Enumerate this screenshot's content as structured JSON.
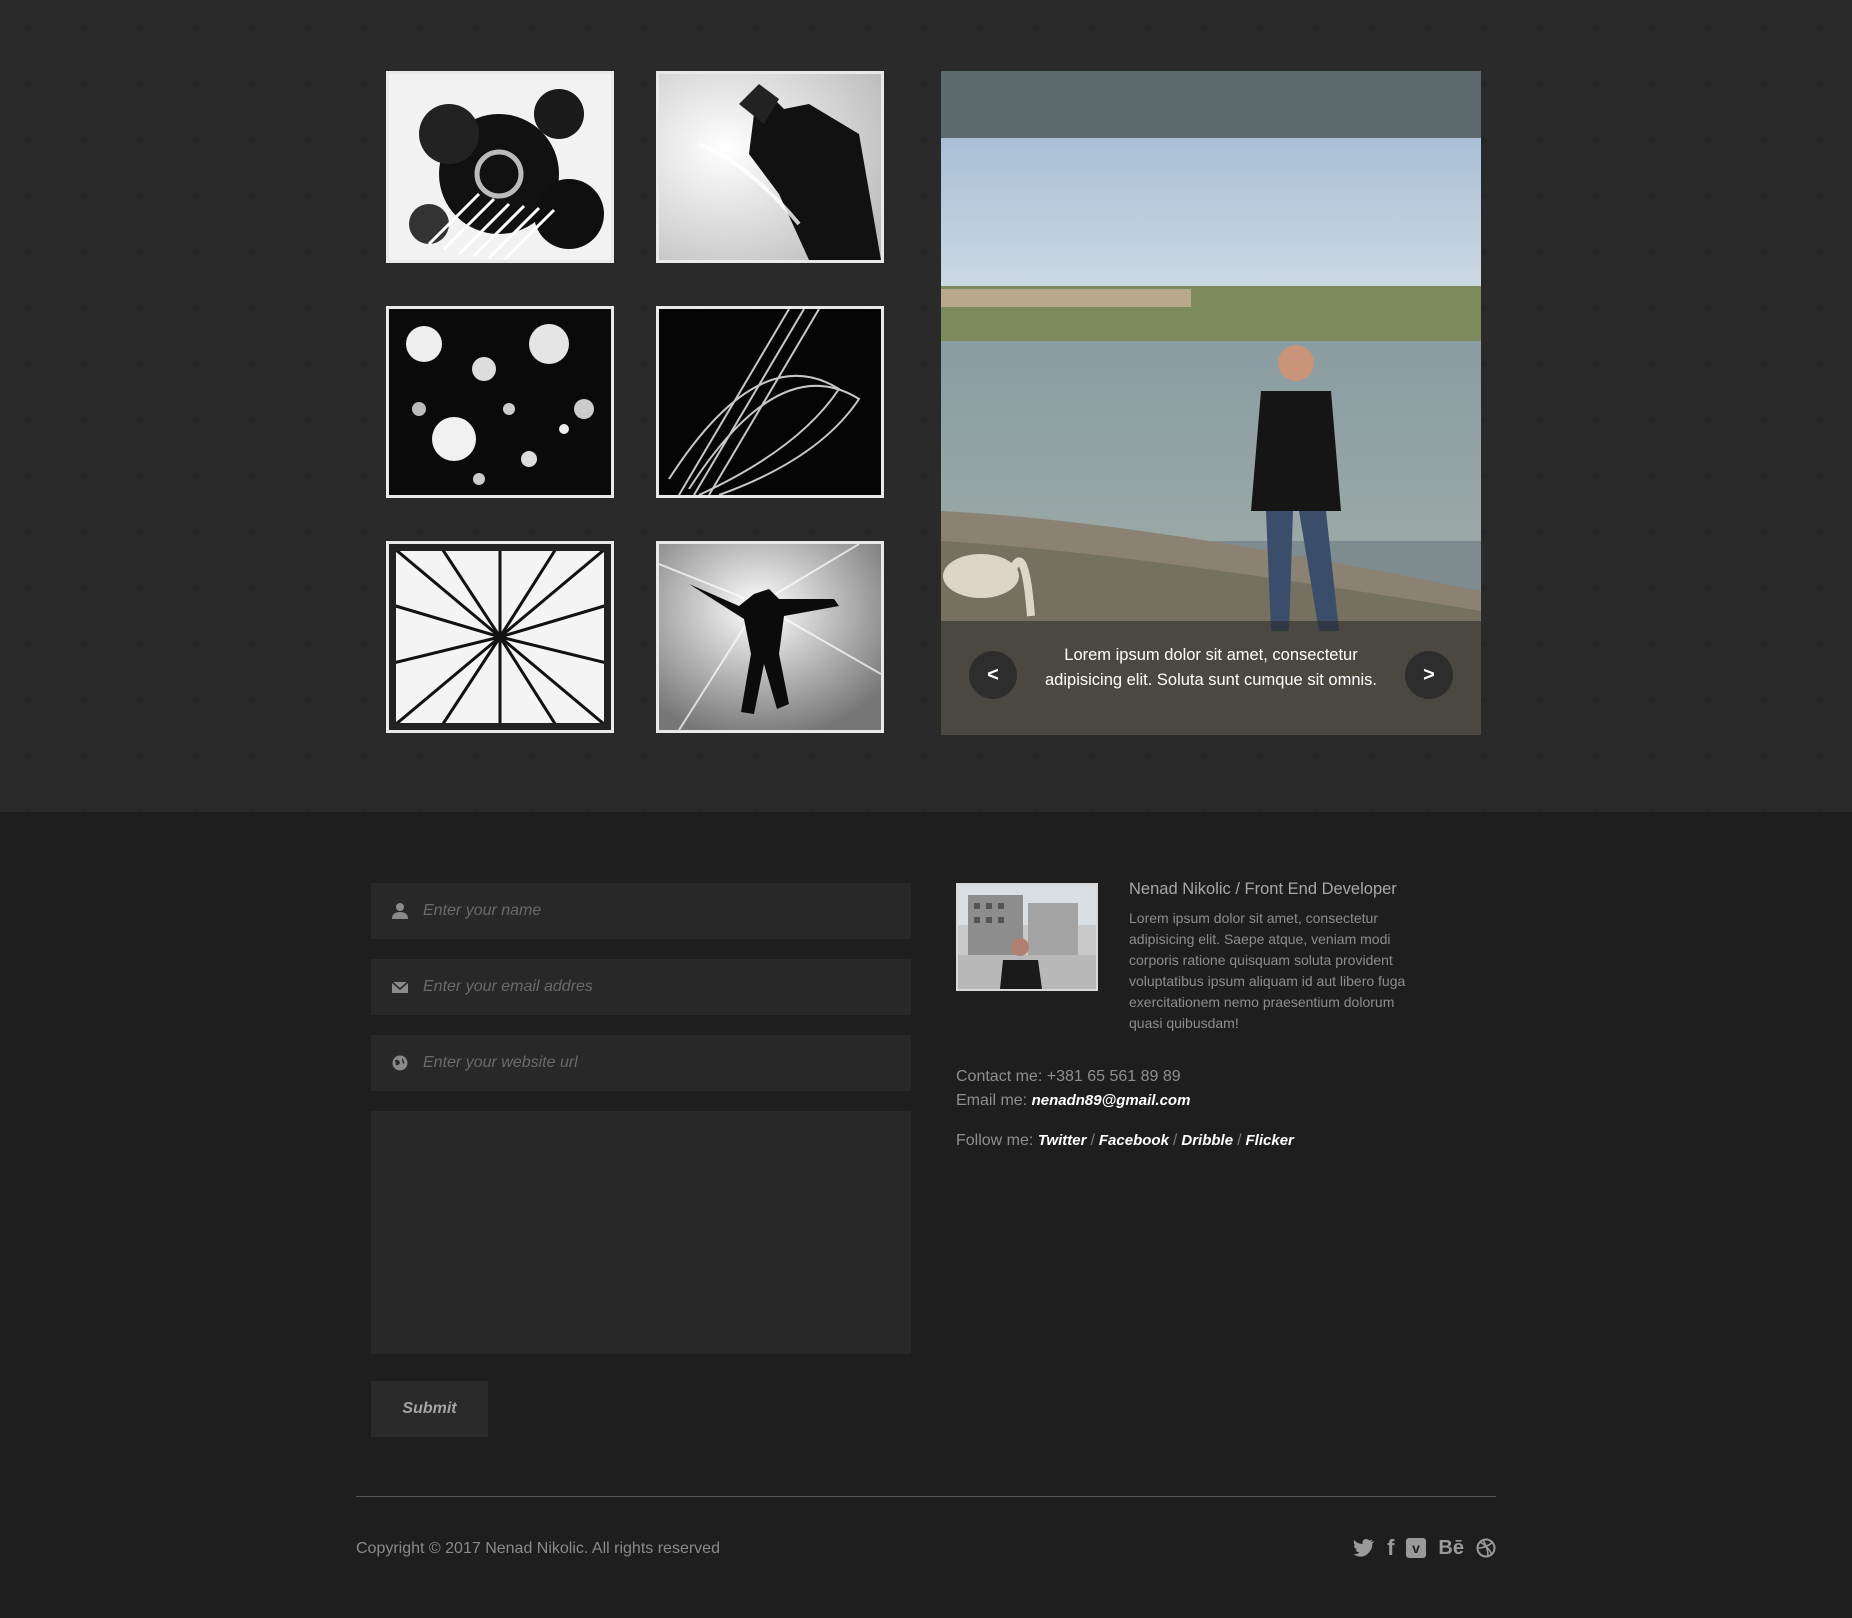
{
  "gallery": {
    "thumbs": [
      {
        "name": "splatter-art",
        "alt": "splatter"
      },
      {
        "name": "spiky-hair-man",
        "alt": "man"
      },
      {
        "name": "bubbles-art",
        "alt": "bubbles"
      },
      {
        "name": "light-trails",
        "alt": "light"
      },
      {
        "name": "rays-burst",
        "alt": "rays"
      },
      {
        "name": "jumping-girl",
        "alt": "jump"
      }
    ]
  },
  "slider": {
    "caption": "Lorem ipsum dolor sit amet, consectetur adipisicing elit. Soluta sunt cumque sit omnis.",
    "prev_label": "<",
    "next_label": ">"
  },
  "form": {
    "name_placeholder": "Enter your name",
    "email_placeholder": "Enter your email addres",
    "website_placeholder": "Enter your website url",
    "submit_label": "Submit"
  },
  "profile": {
    "name": "Nenad Nikolic / Front End Developer",
    "bio": "Lorem ipsum dolor sit amet, consectetur adipisicing elit. Saepe atque, veniam modi corporis ratione quisquam soluta provident voluptatibus ipsum aliquam id aut libero fuga exercitationem nemo praesentium dolorum quasi quibusdam!"
  },
  "contact": {
    "phone_label": "Contact me:",
    "phone": "+381 65 561 89 89",
    "email_label": "Email me:",
    "email": "nenadn89@gmail.com",
    "follow_label": "Follow me:",
    "links": [
      "Twitter",
      "Facebook",
      "Dribble",
      "Flicker"
    ]
  },
  "footer": {
    "copyright": "Copyright © 2017 Nenad Nikolic. All rights reserved",
    "social_icons": [
      "twitter-icon",
      "facebook-icon",
      "vimeo-icon",
      "behance-icon",
      "dribbble-icon"
    ],
    "social_labels": {
      "facebook": "f",
      "vimeo": "v",
      "behance": "Bē"
    }
  },
  "colors": {
    "top_bg": "#2a2a2a",
    "bottom_bg": "#1e1e1e",
    "field_bg": "#282828",
    "link": "#ffffff"
  }
}
